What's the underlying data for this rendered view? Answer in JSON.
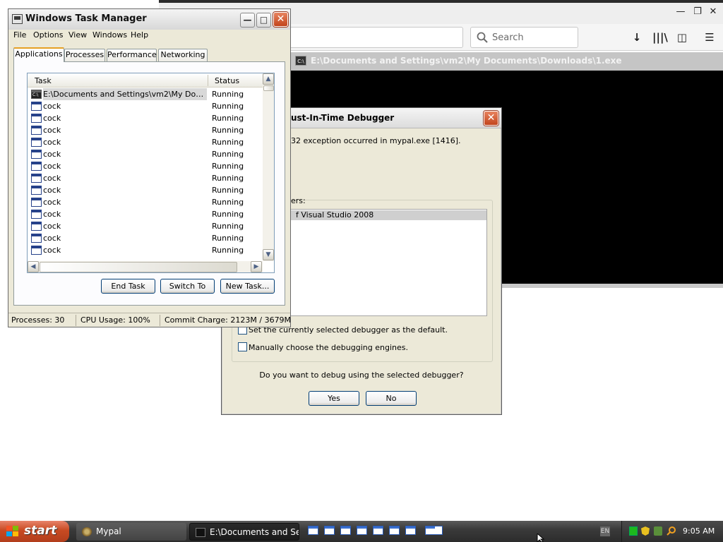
{
  "firefox": {
    "search": {
      "placeholder": "Search"
    }
  },
  "console": {
    "title": "E:\\Documents and Settings\\vm2\\My Documents\\Downloads\\1.exe"
  },
  "jit_debugger": {
    "title": "ust-In-Time Debugger",
    "message": "32 exception occurred in mypal.exe [1416].",
    "debuggers_label": "ers:",
    "debuggers": [
      "f Visual Studio 2008"
    ],
    "checkbox_default_label": "Set the currently selected debugger as the default.",
    "checkbox_engines_label": "Manually choose the debugging engines.",
    "question": "Do you want to debug using the selected debugger?",
    "yes_label": "Yes",
    "no_label": "No"
  },
  "task_manager": {
    "title": "Windows Task Manager",
    "menu": [
      "File",
      "Options",
      "View",
      "Windows",
      "Help"
    ],
    "tabs": [
      "Applications",
      "Processes",
      "Performance",
      "Networking"
    ],
    "active_tab": "Applications",
    "columns": {
      "task": "Task",
      "status": "Status"
    },
    "rows": [
      {
        "task": "E:\\Documents and Settings\\vm2\\My Documents\\Downloads\\1.exe",
        "status": "Running",
        "icon": "cmd-icon"
      },
      {
        "task": "cock",
        "status": "Running",
        "icon": "window-icon"
      },
      {
        "task": "cock",
        "status": "Running",
        "icon": "window-icon"
      },
      {
        "task": "cock",
        "status": "Running",
        "icon": "window-icon"
      },
      {
        "task": "cock",
        "status": "Running",
        "icon": "window-icon"
      },
      {
        "task": "cock",
        "status": "Running",
        "icon": "window-icon"
      },
      {
        "task": "cock",
        "status": "Running",
        "icon": "window-icon"
      },
      {
        "task": "cock",
        "status": "Running",
        "icon": "window-icon"
      },
      {
        "task": "cock",
        "status": "Running",
        "icon": "window-icon"
      },
      {
        "task": "cock",
        "status": "Running",
        "icon": "window-icon"
      },
      {
        "task": "cock",
        "status": "Running",
        "icon": "window-icon"
      },
      {
        "task": "cock",
        "status": "Running",
        "icon": "window-icon"
      },
      {
        "task": "cock",
        "status": "Running",
        "icon": "window-icon"
      },
      {
        "task": "cock",
        "status": "Running",
        "icon": "window-icon"
      }
    ],
    "buttons": {
      "end_task": "End Task",
      "switch_to": "Switch To",
      "new_task": "New Task..."
    },
    "status_bar": {
      "processes": "Processes: 30",
      "cpu": "CPU Usage: 100%",
      "commit": "Commit Charge: 2123M / 3679M"
    }
  },
  "taskbar": {
    "start_label": "start",
    "buttons": [
      {
        "label": "Mypal",
        "icon": "mypal-icon"
      },
      {
        "label": "E:\\Documents and Se...",
        "icon": "cmd-icon"
      }
    ],
    "language": "EN",
    "clock": "9:05 AM"
  }
}
